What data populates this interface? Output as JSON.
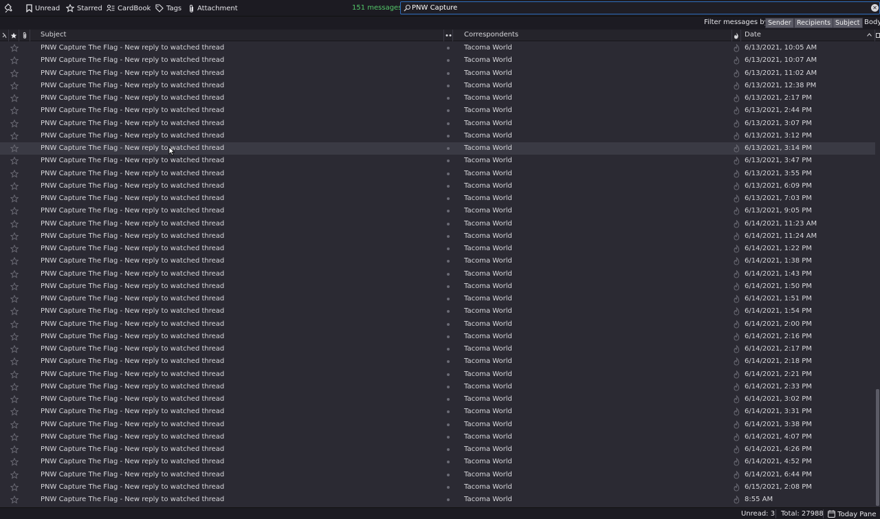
{
  "quick_filter": {
    "pin_icon": "pin-icon",
    "buttons": [
      {
        "label": "Unread",
        "icon": "bookmark-icon"
      },
      {
        "label": "Starred",
        "icon": "star-icon"
      },
      {
        "label": "CardBook",
        "icon": "contact-card-icon"
      },
      {
        "label": "Tags",
        "icon": "tag-icon"
      },
      {
        "label": "Attachment",
        "icon": "paperclip-icon"
      }
    ],
    "message_count": "151 messages",
    "search_value": "PNW Capture"
  },
  "filter_by": {
    "label": "Filter messages by:",
    "options": [
      "Sender",
      "Recipients",
      "Subject"
    ],
    "body_label": "Body"
  },
  "columns": {
    "subject": "Subject",
    "correspondents": "Correspondents",
    "date": "Date"
  },
  "messages": [
    {
      "subject": "PNW Capture The Flag - New reply to watched thread",
      "correspondent": "Tacoma World",
      "date": "6/13/2021, 10:05 AM"
    },
    {
      "subject": "PNW Capture The Flag - New reply to watched thread",
      "correspondent": "Tacoma World",
      "date": "6/13/2021, 10:07 AM"
    },
    {
      "subject": "PNW Capture The Flag - New reply to watched thread",
      "correspondent": "Tacoma World",
      "date": "6/13/2021, 11:02 AM"
    },
    {
      "subject": "PNW Capture The Flag - New reply to watched thread",
      "correspondent": "Tacoma World",
      "date": "6/13/2021, 12:38 PM"
    },
    {
      "subject": "PNW Capture The Flag - New reply to watched thread",
      "correspondent": "Tacoma World",
      "date": "6/13/2021, 2:17 PM"
    },
    {
      "subject": "PNW Capture The Flag - New reply to watched thread",
      "correspondent": "Tacoma World",
      "date": "6/13/2021, 2:44 PM"
    },
    {
      "subject": "PNW Capture The Flag - New reply to watched thread",
      "correspondent": "Tacoma World",
      "date": "6/13/2021, 3:07 PM"
    },
    {
      "subject": "PNW Capture The Flag - New reply to watched thread",
      "correspondent": "Tacoma World",
      "date": "6/13/2021, 3:12 PM"
    },
    {
      "subject": "PNW Capture The Flag - New reply to watched thread",
      "correspondent": "Tacoma World",
      "date": "6/13/2021, 3:14 PM"
    },
    {
      "subject": "PNW Capture The Flag - New reply to watched thread",
      "correspondent": "Tacoma World",
      "date": "6/13/2021, 3:47 PM"
    },
    {
      "subject": "PNW Capture The Flag - New reply to watched thread",
      "correspondent": "Tacoma World",
      "date": "6/13/2021, 3:55 PM"
    },
    {
      "subject": "PNW Capture The Flag - New reply to watched thread",
      "correspondent": "Tacoma World",
      "date": "6/13/2021, 6:09 PM"
    },
    {
      "subject": "PNW Capture The Flag - New reply to watched thread",
      "correspondent": "Tacoma World",
      "date": "6/13/2021, 7:03 PM"
    },
    {
      "subject": "PNW Capture The Flag - New reply to watched thread",
      "correspondent": "Tacoma World",
      "date": "6/13/2021, 9:05 PM"
    },
    {
      "subject": "PNW Capture The Flag - New reply to watched thread",
      "correspondent": "Tacoma World",
      "date": "6/14/2021, 11:23 AM"
    },
    {
      "subject": "PNW Capture The Flag - New reply to watched thread",
      "correspondent": "Tacoma World",
      "date": "6/14/2021, 11:24 AM"
    },
    {
      "subject": "PNW Capture The Flag - New reply to watched thread",
      "correspondent": "Tacoma World",
      "date": "6/14/2021, 1:22 PM"
    },
    {
      "subject": "PNW Capture The Flag - New reply to watched thread",
      "correspondent": "Tacoma World",
      "date": "6/14/2021, 1:38 PM"
    },
    {
      "subject": "PNW Capture The Flag - New reply to watched thread",
      "correspondent": "Tacoma World",
      "date": "6/14/2021, 1:43 PM"
    },
    {
      "subject": "PNW Capture The Flag - New reply to watched thread",
      "correspondent": "Tacoma World",
      "date": "6/14/2021, 1:50 PM"
    },
    {
      "subject": "PNW Capture The Flag - New reply to watched thread",
      "correspondent": "Tacoma World",
      "date": "6/14/2021, 1:51 PM"
    },
    {
      "subject": "PNW Capture The Flag - New reply to watched thread",
      "correspondent": "Tacoma World",
      "date": "6/14/2021, 1:54 PM"
    },
    {
      "subject": "PNW Capture The Flag - New reply to watched thread",
      "correspondent": "Tacoma World",
      "date": "6/14/2021, 2:00 PM"
    },
    {
      "subject": "PNW Capture The Flag - New reply to watched thread",
      "correspondent": "Tacoma World",
      "date": "6/14/2021, 2:16 PM"
    },
    {
      "subject": "PNW Capture The Flag - New reply to watched thread",
      "correspondent": "Tacoma World",
      "date": "6/14/2021, 2:17 PM"
    },
    {
      "subject": "PNW Capture The Flag - New reply to watched thread",
      "correspondent": "Tacoma World",
      "date": "6/14/2021, 2:18 PM"
    },
    {
      "subject": "PNW Capture The Flag - New reply to watched thread",
      "correspondent": "Tacoma World",
      "date": "6/14/2021, 2:21 PM"
    },
    {
      "subject": "PNW Capture The Flag - New reply to watched thread",
      "correspondent": "Tacoma World",
      "date": "6/14/2021, 2:33 PM"
    },
    {
      "subject": "PNW Capture The Flag - New reply to watched thread",
      "correspondent": "Tacoma World",
      "date": "6/14/2021, 3:02 PM"
    },
    {
      "subject": "PNW Capture The Flag - New reply to watched thread",
      "correspondent": "Tacoma World",
      "date": "6/14/2021, 3:31 PM"
    },
    {
      "subject": "PNW Capture The Flag - New reply to watched thread",
      "correspondent": "Tacoma World",
      "date": "6/14/2021, 3:38 PM"
    },
    {
      "subject": "PNW Capture The Flag - New reply to watched thread",
      "correspondent": "Tacoma World",
      "date": "6/14/2021, 4:07 PM"
    },
    {
      "subject": "PNW Capture The Flag - New reply to watched thread",
      "correspondent": "Tacoma World",
      "date": "6/14/2021, 4:26 PM"
    },
    {
      "subject": "PNW Capture The Flag - New reply to watched thread",
      "correspondent": "Tacoma World",
      "date": "6/14/2021, 4:52 PM"
    },
    {
      "subject": "PNW Capture The Flag - New reply to watched thread",
      "correspondent": "Tacoma World",
      "date": "6/14/2021, 6:44 PM"
    },
    {
      "subject": "PNW Capture The Flag - New reply to watched thread",
      "correspondent": "Tacoma World",
      "date": "6/15/2021, 2:08 PM"
    },
    {
      "subject": "PNW Capture The Flag - New reply to watched thread",
      "correspondent": "Tacoma World",
      "date": "8:55 AM"
    }
  ],
  "hovered_row": 8,
  "status": {
    "unread": "Unread: 3",
    "total": "Total: 27988",
    "today_pane": "Today Pane"
  }
}
